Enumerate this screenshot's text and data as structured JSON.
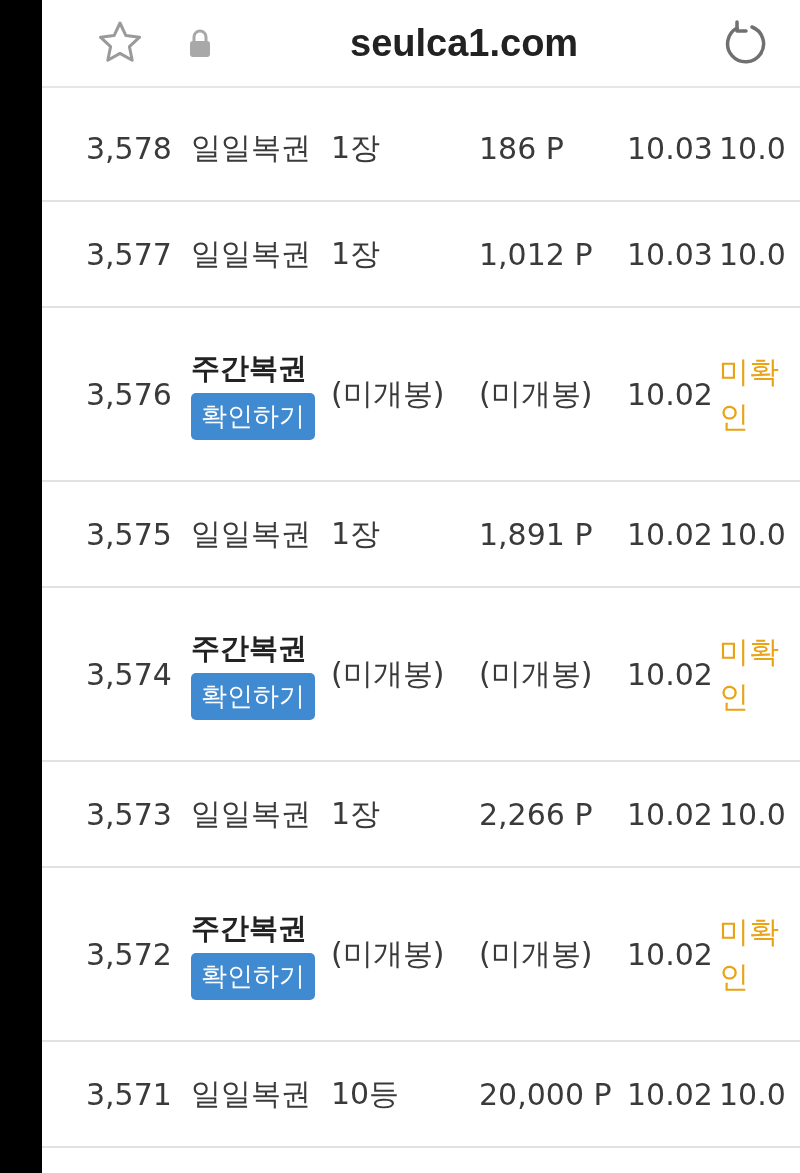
{
  "browser": {
    "url": "seulca1.com"
  },
  "rows": [
    {
      "kind": "daily",
      "number": "3,578",
      "name": "일일복권",
      "count": "1장",
      "points": "186 P",
      "date": "10.03",
      "date_2": "10.0"
    },
    {
      "kind": "daily",
      "number": "3,577",
      "name": "일일복권",
      "count": "1장",
      "points": "1,012 P",
      "date": "10.03",
      "date_2": "10.0"
    },
    {
      "kind": "weekly",
      "number": "3,576",
      "name": "주간복권",
      "button": "확인하기",
      "count": "(미개봉)",
      "points": "(미개봉)",
      "date": "10.02",
      "status": "미확인"
    },
    {
      "kind": "daily",
      "number": "3,575",
      "name": "일일복권",
      "count": "1장",
      "points": "1,891 P",
      "date": "10.02",
      "date_2": "10.0"
    },
    {
      "kind": "weekly",
      "number": "3,574",
      "name": "주간복권",
      "button": "확인하기",
      "count": "(미개봉)",
      "points": "(미개봉)",
      "date": "10.02",
      "status": "미확인"
    },
    {
      "kind": "daily",
      "number": "3,573",
      "name": "일일복권",
      "count": "1장",
      "points": "2,266 P",
      "date": "10.02",
      "date_2": "10.0"
    },
    {
      "kind": "weekly",
      "number": "3,572",
      "name": "주간복권",
      "button": "확인하기",
      "count": "(미개봉)",
      "points": "(미개봉)",
      "date": "10.02",
      "status": "미확인"
    },
    {
      "kind": "daily",
      "number": "3,571",
      "name": "일일복권",
      "count": "10등",
      "points": "20,000 P",
      "date": "10.02",
      "date_2": "10.0"
    }
  ]
}
